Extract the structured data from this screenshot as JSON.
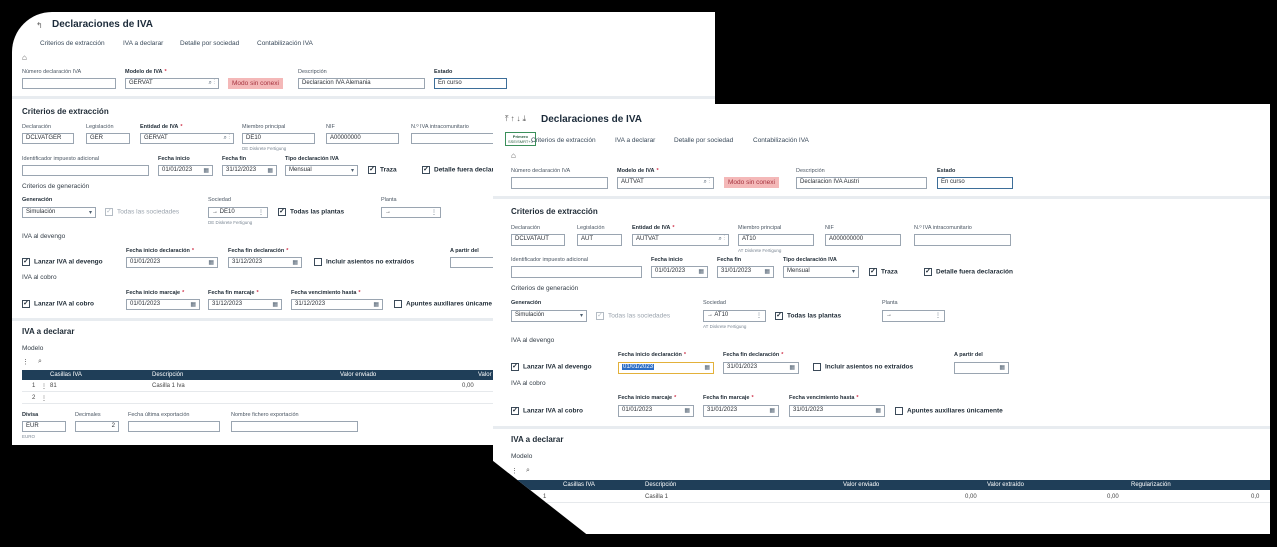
{
  "back": {
    "title": "Declaraciones de IVA",
    "tabs": [
      "Criterios de extracción",
      "IVA a declarar",
      "Detalle por sociedad",
      "Contabilización IVA"
    ],
    "header": {
      "numero_label": "Número declaración IVA",
      "numero_value": "",
      "modelo_label": "Modelo de IVA",
      "modelo_value": "GERVAT",
      "offline_badge": "Modo sin conexi",
      "desc_label": "Descripción",
      "desc_value": "Declaracion IVA Alemania",
      "estado_label": "Estado",
      "estado_value": "En curso"
    },
    "criterios": {
      "title": "Criterios de extracción",
      "declaracion_label": "Declaración",
      "declaracion_value": "DCLVATGER",
      "legislacion_label": "Legislación",
      "legislacion_value": "GER",
      "entidad_label": "Entidad de IVA",
      "entidad_value": "GERVAT",
      "miembro_label": "Miembro principal",
      "miembro_value": "DE10",
      "miembro_hint": "DE Diskrete Fertigung",
      "nif_label": "NIF",
      "nif_value": "A00000000",
      "intra_label": "N.º IVA intracomunitario",
      "identificador_label": "Identificador impuesto adicional",
      "fecha_inicio_label": "Fecha inicio",
      "fecha_inicio_value": "01/01/2023",
      "fecha_fin_label": "Fecha fin",
      "fecha_fin_value": "31/12/2023",
      "tipo_label": "Tipo declaración IVA",
      "tipo_value": "Mensual",
      "traza_label": "Traza",
      "detalle_label": "Detalle fuera declar",
      "generacion_title": "Criterios de generación",
      "generacion_label": "Generación",
      "generacion_value": "Simulación",
      "todas_soc_label": "Todas las sociedades",
      "sociedad_label": "Sociedad",
      "sociedad_value": "DE10",
      "sociedad_hint": "DE Diskrete Fertigung",
      "todas_plantas_label": "Todas las plantas",
      "planta_label": "Planta",
      "devengo_title": "IVA al devengo",
      "lanzar_devengo_label": "Lanzar IVA al devengo",
      "fid_label": "Fecha inicio declaración",
      "fid_value": "01/01/2023",
      "ffd_label": "Fecha fin declaración",
      "ffd_value": "31/12/2023",
      "incluir_label": "Incluir asientos no extraídos",
      "apartir_label": "A partir del",
      "cobro_title": "IVA al cobro",
      "lanzar_cobro_label": "Lanzar IVA al cobro",
      "fim_label": "Fecha inicio marcaje",
      "fim_value": "01/01/2023",
      "ffm_label": "Fecha fin marcaje",
      "ffm_value": "31/12/2023",
      "fvh_label": "Fecha vencimiento hasta",
      "fvh_value": "31/12/2023",
      "apuntes_label": "Apuntes auxiliares únicame"
    },
    "iva": {
      "title": "IVA a declarar",
      "modelo_label": "Modelo",
      "columns": [
        "Casillas IVA",
        "Descripción",
        "Valor enviado",
        "Valor"
      ],
      "rows": [
        {
          "n": "1",
          "casilla": "81",
          "desc": "Casilla 1 Iva",
          "valor": "0,00"
        },
        {
          "n": "2",
          "casilla": "",
          "desc": "",
          "valor": ""
        }
      ],
      "divisa_label": "Divisa",
      "divisa_value": "EUR",
      "divisa_hint": "EURO",
      "decimales_label": "Decimales",
      "decimales_value": "2",
      "fecha_exp_label": "Fecha última exportación",
      "nombre_label": "Nombre fichero exportación"
    }
  },
  "front": {
    "title": "Declaraciones de IVA",
    "first_flag": "Primero",
    "first_flag_sub": "SSE/SMRT+J",
    "tabs": [
      "Criterios de extracción",
      "IVA a declarar",
      "Detalle por sociedad",
      "Contabilización IVA"
    ],
    "header": {
      "numero_label": "Número declaración IVA",
      "numero_value": "",
      "modelo_label": "Modelo de IVA",
      "modelo_value": "AUTVAT",
      "offline_badge": "Modo sin conexi",
      "desc_label": "Descripción",
      "desc_value": "Declaracion IVA Austri",
      "estado_label": "Estado",
      "estado_value": "En curso"
    },
    "criterios": {
      "title": "Criterios de extracción",
      "declaracion_label": "Declaración",
      "declaracion_value": "DCLVATAUT",
      "legislacion_label": "Legislación",
      "legislacion_value": "AUT",
      "entidad_label": "Entidad de IVA",
      "entidad_value": "AUTVAT",
      "miembro_label": "Miembro principal",
      "miembro_value": "AT10",
      "miembro_hint": "AT Diskrete Fertigung",
      "nif_label": "NIF",
      "nif_value": "A000000000",
      "intra_label": "N.º IVA intracomunitario",
      "identificador_label": "Identificador impuesto adicional",
      "fecha_inicio_label": "Fecha inicio",
      "fecha_inicio_value": "01/01/2023",
      "fecha_fin_label": "Fecha fin",
      "fecha_fin_value": "31/01/2023",
      "tipo_label": "Tipo declaración IVA",
      "tipo_value": "Mensual",
      "traza_label": "Traza",
      "detalle_label": "Detalle fuera declaración",
      "generacion_title": "Criterios de generación",
      "generacion_label": "Generación",
      "generacion_value": "Simulación",
      "todas_soc_label": "Todas las sociedades",
      "sociedad_label": "Sociedad",
      "sociedad_value": "AT10",
      "sociedad_hint": "AT Diskrete Fertigung",
      "todas_plantas_label": "Todas las plantas",
      "planta_label": "Planta",
      "devengo_title": "IVA al devengo",
      "lanzar_devengo_label": "Lanzar IVA al devengo",
      "fid_label": "Fecha inicio declaración",
      "fid_value": "01/01/2023",
      "ffd_label": "Fecha fin declaración",
      "ffd_value": "31/01/2023",
      "incluir_label": "Incluir asientos no extraídos",
      "apartir_label": "A partir del",
      "cobro_title": "IVA al cobro",
      "lanzar_cobro_label": "Lanzar IVA al cobro",
      "fim_label": "Fecha inicio marcaje",
      "fim_value": "01/01/2023",
      "ffm_label": "Fecha fin marcaje",
      "ffm_value": "31/01/2023",
      "fvh_label": "Fecha vencimiento hasta",
      "fvh_value": "31/01/2023",
      "apuntes_label": "Apuntes auxiliares únicamente"
    },
    "iva": {
      "title": "IVA a declarar",
      "modelo_label": "Modelo",
      "columns": [
        "Casillas IVA",
        "Descripción",
        "Valor enviado",
        "Valor extraído",
        "Regularización"
      ],
      "rows": [
        {
          "n": "1",
          "casilla": "",
          "desc": "Casilla 1",
          "enviado": "0,00",
          "extraido": "0,00",
          "regul": "0,0"
        }
      ]
    }
  }
}
